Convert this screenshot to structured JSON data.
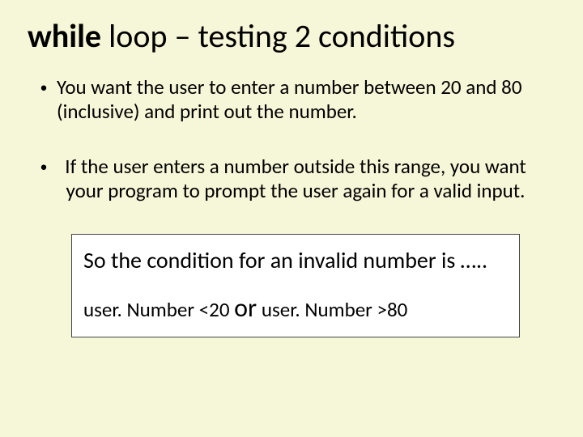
{
  "title": {
    "bold": "while",
    "rest": " loop – testing 2 conditions"
  },
  "bullets": [
    "You want the user to enter a number between 20 and 80 (inclusive) and print out the number.",
    "If the user enters a number outside this range, you want your program to prompt the user again for a valid input."
  ],
  "box": {
    "line1": "So the condition for an invalid number is …..",
    "line2_a": "user. Number <20 ",
    "line2_or": "or",
    "line2_b": " user. Number >80"
  }
}
